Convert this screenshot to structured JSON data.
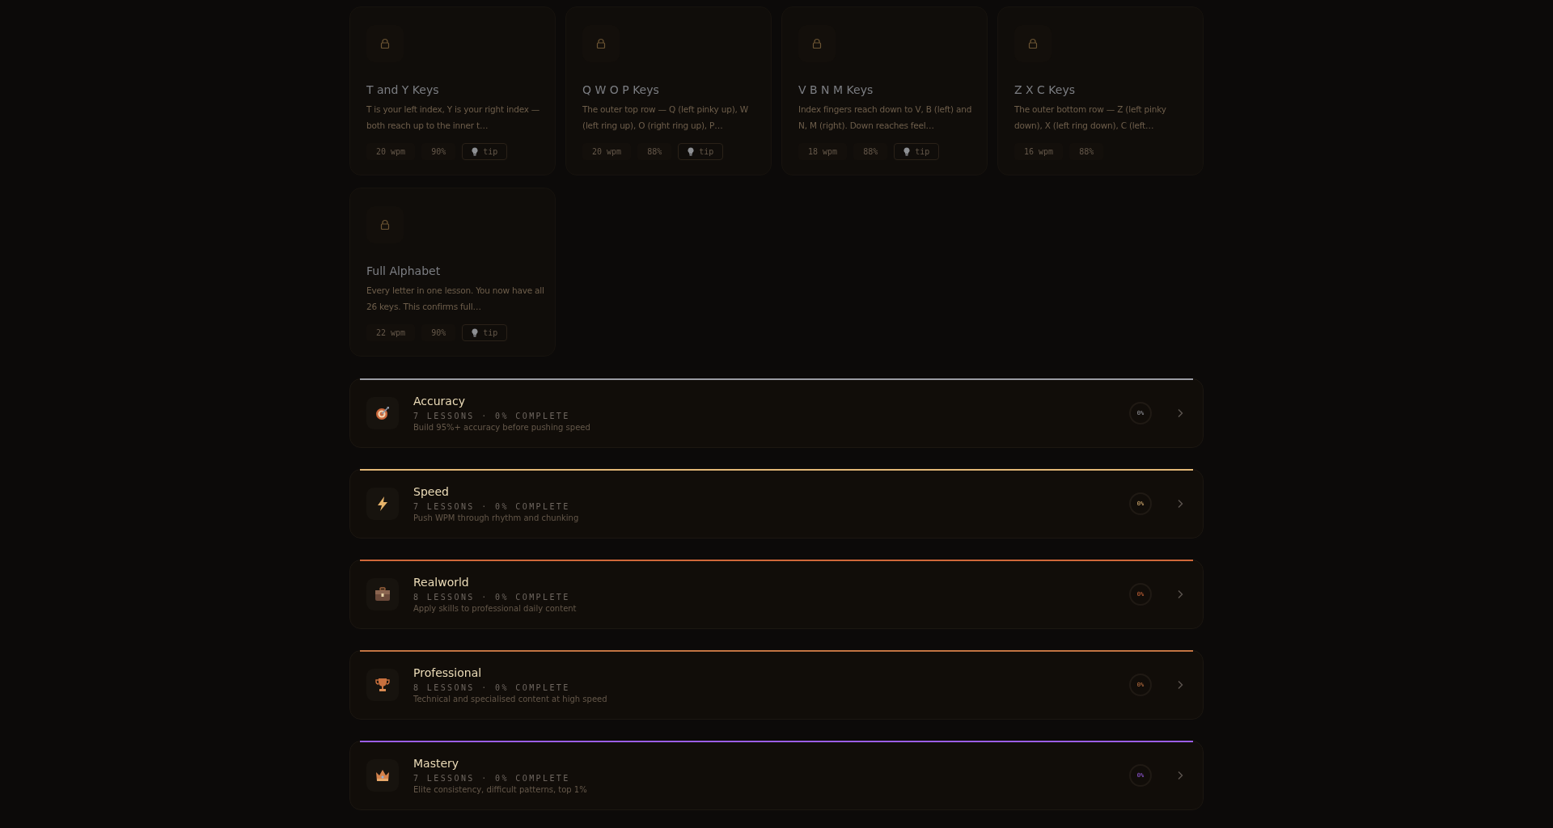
{
  "lessons": [
    {
      "title": "T and Y Keys",
      "description": "T is your left index, Y is your right index — both reach up to the inner t…",
      "wpm": "20 wpm",
      "accuracy": "90%",
      "tip": "tip",
      "locked": true
    },
    {
      "title": "Q W O P Keys",
      "description": "The outer top row — Q (left pinky up), W (left ring up), O (right ring up), P…",
      "wpm": "20 wpm",
      "accuracy": "88%",
      "tip": "tip",
      "locked": true
    },
    {
      "title": "V B N M Keys",
      "description": "Index fingers reach down to V, B (left) and N, M (right). Down reaches feel…",
      "wpm": "18 wpm",
      "accuracy": "88%",
      "tip": "tip",
      "locked": true
    },
    {
      "title": "Z X C Keys",
      "description": "The outer bottom row — Z (left pinky down), X (left ring down), C (left…",
      "wpm": "16 wpm",
      "accuracy": "88%",
      "locked": true
    },
    {
      "title": "Full Alphabet",
      "description": "Every letter in one lesson. You now have all 26 keys. This confirms full…",
      "wpm": "22 wpm",
      "accuracy": "90%",
      "tip": "tip",
      "locked": true
    }
  ],
  "sections": [
    {
      "kind": "target",
      "name": "Accuracy",
      "meta": "7 LESSONS · 0% COMPLETE",
      "description": "Build 95%+ accuracy before pushing speed",
      "percent": "0%",
      "level": 0,
      "color": "#9a9ca3"
    },
    {
      "kind": "bolt",
      "name": "Speed",
      "meta": "7 LESSONS · 0% COMPLETE",
      "description": "Push WPM through rhythm and chunking",
      "percent": "0%",
      "level": 0,
      "color": "#e3b877"
    },
    {
      "kind": "briefcase",
      "name": "Realworld",
      "meta": "8 LESSONS · 0% COMPLETE",
      "description": "Apply skills to professional daily content",
      "percent": "0%",
      "level": 0,
      "color": "#d0683a"
    },
    {
      "kind": "trophy",
      "name": "Professional",
      "meta": "8 LESSONS · 0% COMPLETE",
      "description": "Technical and specialised content at high speed",
      "percent": "0%",
      "level": 0,
      "color": "#c27443"
    },
    {
      "kind": "crown",
      "name": "Mastery",
      "meta": "7 LESSONS · 0% COMPLETE",
      "description": "Elite consistency, difficult patterns, top 1%",
      "percent": "0%",
      "level": 0,
      "color": "#9b5de5"
    }
  ]
}
